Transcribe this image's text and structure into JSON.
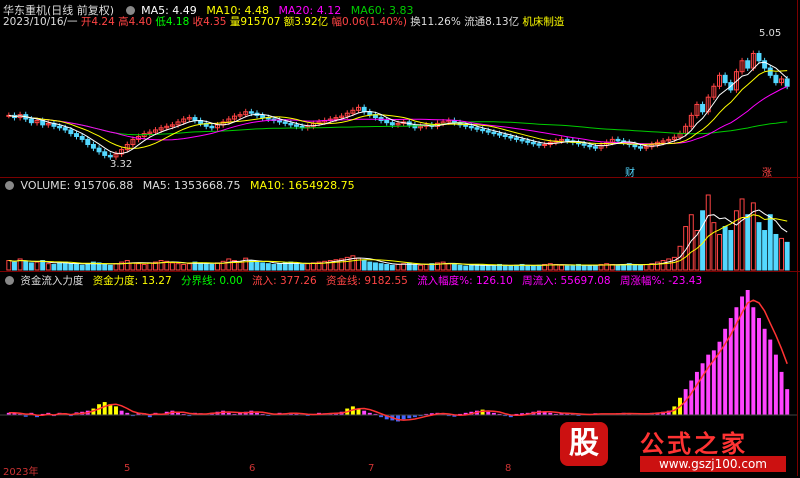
{
  "header": {
    "title": "华东重机(日线 前复权)",
    "ma5_label": "MA5: 4.49",
    "ma10_label": "MA10: 4.48",
    "ma20_label": "MA20: 4.12",
    "ma60_label": "MA60: 3.83",
    "date": "2023/10/16/一",
    "open": "开4.24",
    "high": "高4.40",
    "low": "低4.18",
    "close": "收4.35",
    "volume": "量915707",
    "amount": "额3.92亿",
    "change": "幅0.06(1.40%)",
    "turnover": "换11.26%",
    "float_cap": "流通8.13亿",
    "sector": "机床制造"
  },
  "volume_panel": {
    "label": "VOLUME: 915706.88",
    "ma5": "MA5: 1353668.75",
    "ma10": "MA10: 1654928.75"
  },
  "flow_panel": {
    "title": "资金流入力度",
    "strength": "资金力度: 13.27",
    "divider": "分界线: 0.00",
    "inflow": "流入: 377.26",
    "fund_line": "资金线: 9182.55",
    "inflow_pct": "流入幅度%: 126.10",
    "week_inflow": "周流入: 55697.08",
    "week_pct": "周涨幅%: -23.43"
  },
  "annotations": {
    "high_price": "5.05",
    "low_price": "3.32",
    "badge_cai": "财",
    "badge_zhang": "涨"
  },
  "axis": {
    "months": [
      "2023年",
      "5",
      "6",
      "7",
      "8"
    ]
  },
  "watermark": {
    "logo_char": "股",
    "site_name": "公式之家",
    "url": "www.gszj100.com"
  },
  "colors": {
    "up": "#ff4444",
    "down": "#54d8ff",
    "ma5": "#ffffff",
    "ma10": "#ffff00",
    "ma20": "#ff00ff",
    "ma60": "#00cc00",
    "bg": "#000000"
  },
  "chart_data": [
    {
      "type": "candlestick",
      "title": "华东重机(日线 前复权)",
      "price_range": [
        3.32,
        5.05
      ],
      "annotated_high": 5.05,
      "annotated_low": 3.32,
      "last_bar": {
        "open": 4.24,
        "high": 4.4,
        "low": 4.18,
        "close": 4.35
      },
      "closes": [
        3.95,
        3.92,
        3.96,
        3.9,
        3.85,
        3.88,
        3.82,
        3.84,
        3.8,
        3.78,
        3.75,
        3.7,
        3.66,
        3.62,
        3.55,
        3.5,
        3.45,
        3.4,
        3.38,
        3.42,
        3.48,
        3.55,
        3.62,
        3.66,
        3.7,
        3.72,
        3.75,
        3.78,
        3.8,
        3.82,
        3.86,
        3.9,
        3.92,
        3.88,
        3.84,
        3.8,
        3.78,
        3.82,
        3.86,
        3.9,
        3.94,
        3.96,
        4.0,
        3.98,
        3.95,
        3.92,
        3.9,
        3.88,
        3.86,
        3.84,
        3.82,
        3.8,
        3.78,
        3.8,
        3.84,
        3.86,
        3.88,
        3.9,
        3.92,
        3.94,
        3.98,
        4.02,
        4.06,
        4.0,
        3.96,
        3.92,
        3.88,
        3.85,
        3.82,
        3.84,
        3.86,
        3.82,
        3.78,
        3.8,
        3.82,
        3.8,
        3.84,
        3.86,
        3.88,
        3.85,
        3.82,
        3.8,
        3.78,
        3.76,
        3.74,
        3.72,
        3.7,
        3.68,
        3.66,
        3.64,
        3.62,
        3.6,
        3.58,
        3.56,
        3.54,
        3.55,
        3.58,
        3.6,
        3.62,
        3.6,
        3.58,
        3.56,
        3.54,
        3.52,
        3.5,
        3.54,
        3.58,
        3.62,
        3.6,
        3.58,
        3.55,
        3.52,
        3.5,
        3.52,
        3.55,
        3.58,
        3.6,
        3.62,
        3.65,
        3.7,
        3.8,
        3.95,
        4.1,
        4.0,
        4.2,
        4.35,
        4.5,
        4.4,
        4.3,
        4.55,
        4.7,
        4.6,
        4.8,
        4.7,
        4.6,
        4.5,
        4.4,
        4.45,
        4.35
      ],
      "ma5": {
        "name": "MA5",
        "last": 4.49
      },
      "ma10": {
        "name": "MA10",
        "last": 4.48
      },
      "ma20": {
        "name": "MA20",
        "last": 4.12
      },
      "ma60": {
        "name": "MA60",
        "last": 3.83
      }
    },
    {
      "type": "bar",
      "title": "VOLUME",
      "last_value": 915706.88,
      "ma5_last": 1353668.75,
      "ma10_last": 1654928.75,
      "values": [
        0.12,
        0.1,
        0.14,
        0.11,
        0.09,
        0.1,
        0.12,
        0.08,
        0.07,
        0.09,
        0.1,
        0.08,
        0.07,
        0.06,
        0.08,
        0.1,
        0.09,
        0.07,
        0.06,
        0.08,
        0.1,
        0.12,
        0.09,
        0.08,
        0.07,
        0.09,
        0.1,
        0.12,
        0.11,
        0.09,
        0.08,
        0.07,
        0.08,
        0.1,
        0.09,
        0.08,
        0.07,
        0.09,
        0.11,
        0.14,
        0.12,
        0.1,
        0.15,
        0.12,
        0.1,
        0.09,
        0.08,
        0.07,
        0.08,
        0.09,
        0.1,
        0.08,
        0.07,
        0.08,
        0.09,
        0.1,
        0.11,
        0.12,
        0.13,
        0.14,
        0.16,
        0.18,
        0.15,
        0.12,
        0.1,
        0.09,
        0.08,
        0.07,
        0.06,
        0.07,
        0.08,
        0.09,
        0.07,
        0.06,
        0.07,
        0.08,
        0.09,
        0.1,
        0.08,
        0.07,
        0.06,
        0.05,
        0.06,
        0.07,
        0.06,
        0.05,
        0.06,
        0.07,
        0.06,
        0.05,
        0.06,
        0.07,
        0.06,
        0.05,
        0.06,
        0.07,
        0.08,
        0.07,
        0.06,
        0.05,
        0.06,
        0.07,
        0.06,
        0.05,
        0.06,
        0.07,
        0.08,
        0.07,
        0.06,
        0.07,
        0.08,
        0.07,
        0.06,
        0.07,
        0.08,
        0.1,
        0.12,
        0.14,
        0.16,
        0.3,
        0.55,
        0.7,
        0.5,
        0.75,
        0.95,
        0.6,
        0.45,
        0.55,
        0.5,
        0.75,
        0.9,
        0.7,
        0.85,
        0.6,
        0.5,
        0.7,
        0.45,
        0.4,
        0.35
      ]
    },
    {
      "type": "bar",
      "title": "资金流入力度",
      "values": [
        1,
        1,
        0.5,
        -0.8,
        1,
        -1,
        0.5,
        1,
        -0.5,
        1,
        0.8,
        -0.5,
        1.2,
        1.5,
        2,
        3,
        5,
        6,
        5,
        4,
        2,
        1,
        -0.5,
        1,
        0.8,
        -1,
        1,
        0.5,
        1.5,
        2,
        1,
        0.5,
        -0.5,
        1,
        0.8,
        0.5,
        1,
        1.5,
        2,
        1,
        0.5,
        1,
        1.5,
        2,
        1,
        0.5,
        -0.3,
        0.5,
        1,
        0.8,
        1,
        0.5,
        0.3,
        -0.4,
        0.5,
        1,
        0.8,
        0.5,
        1,
        1.5,
        3,
        4,
        3,
        2,
        1,
        0.5,
        -1,
        -2,
        -2.5,
        -3,
        -2,
        -1.5,
        -1,
        -0.5,
        0.5,
        0.8,
        1,
        0.5,
        -0.5,
        -0.8,
        0.5,
        1,
        1.5,
        2,
        2.5,
        1.5,
        1,
        0.5,
        -0.5,
        -1,
        0.5,
        0.8,
        1,
        1.5,
        2,
        1.5,
        1,
        0.5,
        0.8,
        1,
        0.5,
        -0.3,
        0.3,
        0.5,
        0.8,
        0.5,
        0.3,
        0.5,
        0.8,
        1,
        0.5,
        0.3,
        0.5,
        0.8,
        1,
        1.2,
        1.5,
        2,
        4,
        8,
        12,
        16,
        20,
        24,
        28,
        30,
        34,
        40,
        45,
        50,
        55,
        58,
        50,
        45,
        40,
        35,
        28,
        20,
        12
      ],
      "last_value": 13.27,
      "fund_line": 9182.55,
      "divider": 0.0
    }
  ]
}
